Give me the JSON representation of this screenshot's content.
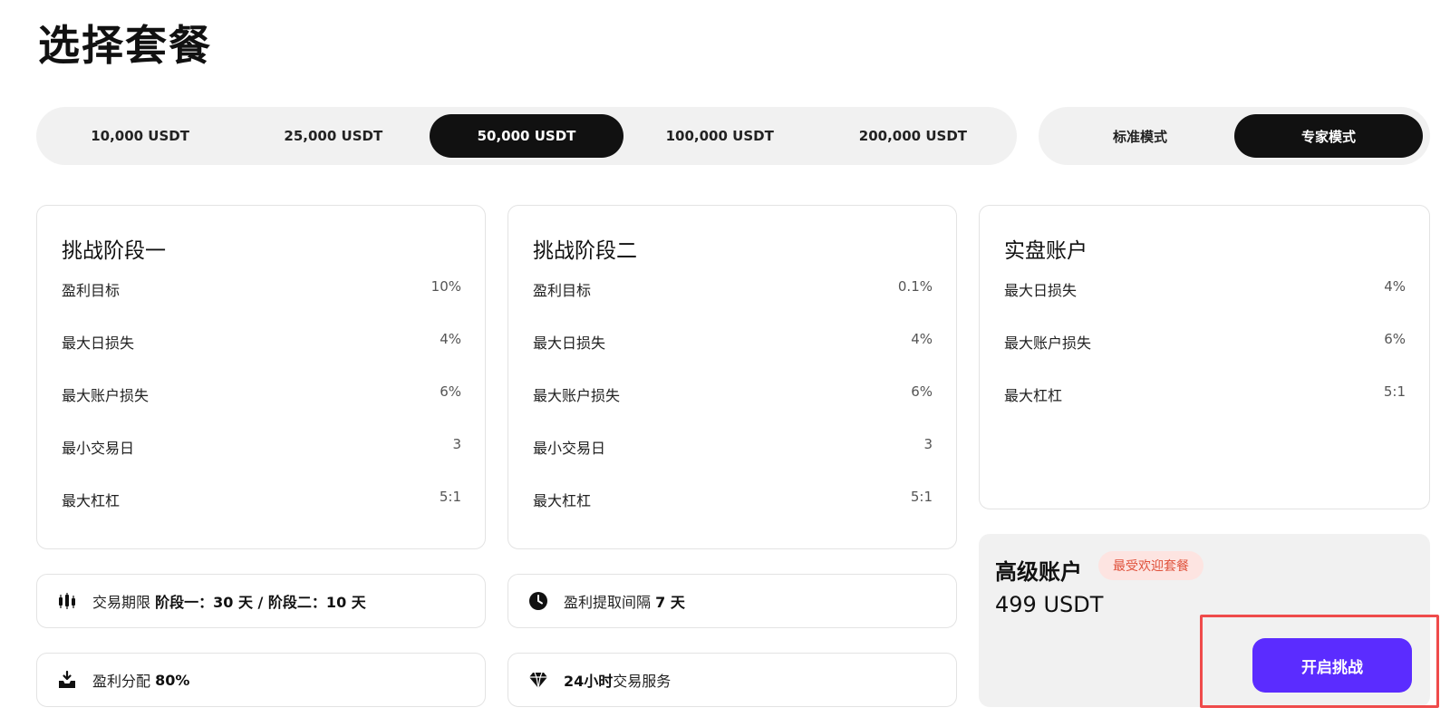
{
  "page": {
    "title": "选择套餐"
  },
  "plans": {
    "items": [
      "10,000 USDT",
      "25,000 USDT",
      "50,000 USDT",
      "100,000 USDT",
      "200,000 USDT"
    ],
    "selected": "50,000 USDT"
  },
  "modes": {
    "items": [
      "标准模式",
      "专家模式"
    ],
    "selected": "专家模式"
  },
  "phase1": {
    "title": "挑战阶段一",
    "rows": [
      {
        "label": "盈利目标",
        "value": "10%"
      },
      {
        "label": "最大日损失",
        "value": "4%"
      },
      {
        "label": "最大账户损失",
        "value": "6%"
      },
      {
        "label": "最小交易日",
        "value": "3"
      },
      {
        "label": "最大杠杠",
        "value": "5:1"
      }
    ]
  },
  "phase2": {
    "title": "挑战阶段二",
    "rows": [
      {
        "label": "盈利目标",
        "value": "0.1%"
      },
      {
        "label": "最大日损失",
        "value": "4%"
      },
      {
        "label": "最大账户损失",
        "value": "6%"
      },
      {
        "label": "最小交易日",
        "value": "3"
      },
      {
        "label": "最大杠杠",
        "value": "5:1"
      }
    ]
  },
  "live": {
    "title": "实盘账户",
    "rows": [
      {
        "label": "最大日损失",
        "value": "4%"
      },
      {
        "label": "最大账户损失",
        "value": "6%"
      },
      {
        "label": "最大杠杠",
        "value": "5:1"
      }
    ]
  },
  "features": {
    "period": {
      "label": "交易期限",
      "value": "阶段一：30 天 / 阶段二：10 天"
    },
    "withdraw": {
      "label": "盈利提取间隔",
      "value": "7 天"
    },
    "split": {
      "label": "盈利分配",
      "value": "80%"
    },
    "service": {
      "strong": "24小时",
      "label": "交易服务"
    }
  },
  "premium": {
    "name": "高级账户",
    "badge": "最受欢迎套餐",
    "price": "499 USDT",
    "cta": "开启挑战"
  },
  "colors": {
    "accent": "#5b2cff",
    "badge_bg": "#fde4e1",
    "badge_text": "#e0523c",
    "highlight": "#ef4b4b"
  },
  "icons": {
    "period": "candlestick-icon",
    "withdraw": "clock-icon",
    "split": "download-tray-icon",
    "service": "diamond-icon"
  }
}
